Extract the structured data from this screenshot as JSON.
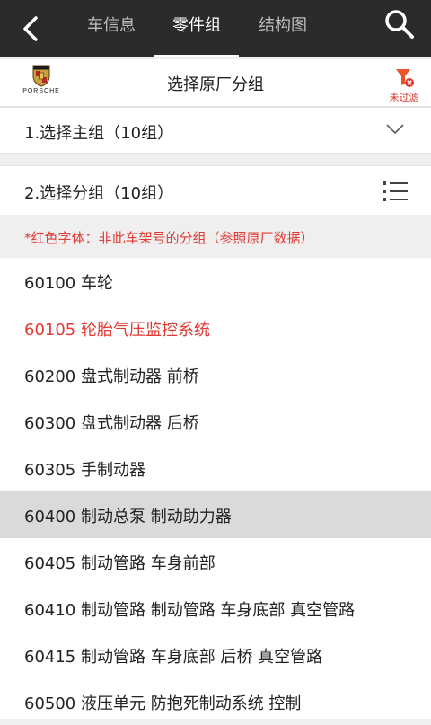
{
  "header": {
    "tabs": [
      {
        "label": "车信息",
        "active": false
      },
      {
        "label": "零件组",
        "active": true
      },
      {
        "label": "结构图",
        "active": false
      }
    ]
  },
  "brand": {
    "logo_text": "PORSCHE",
    "title": "选择原厂分组",
    "filter_label": "未过滤",
    "filter_color": "#e03a33"
  },
  "selectors": {
    "main_group": "1.选择主组（10组）",
    "sub_group": "2.选择分组（10组）"
  },
  "note": "*红色字体：非此车架号的分组（参照原厂数据）",
  "items": [
    {
      "text": "60100 车轮",
      "red": false,
      "selected": false
    },
    {
      "text": "60105 轮胎气压监控系统",
      "red": true,
      "selected": false
    },
    {
      "text": "60200 盘式制动器 前桥",
      "red": false,
      "selected": false
    },
    {
      "text": "60300 盘式制动器 后桥",
      "red": false,
      "selected": false
    },
    {
      "text": "60305 手制动器",
      "red": false,
      "selected": false
    },
    {
      "text": "60400 制动总泵 制动助力器",
      "red": false,
      "selected": true
    },
    {
      "text": "60405 制动管路 车身前部",
      "red": false,
      "selected": false
    },
    {
      "text": "60410 制动管路 制动管路 车身底部 真空管路",
      "red": false,
      "selected": false
    },
    {
      "text": "60415 制动管路 车身底部 后桥 真空管路",
      "red": false,
      "selected": false
    },
    {
      "text": "60500 液压单元 防抱死制动系统 控制",
      "red": false,
      "selected": false
    }
  ]
}
